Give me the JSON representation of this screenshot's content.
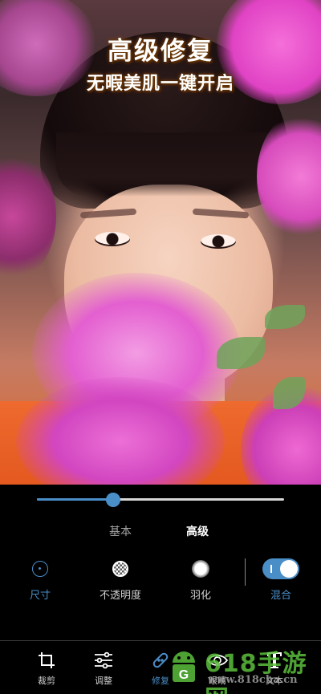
{
  "banner": {
    "title": "高级修复",
    "subtitle": "无暇美肌一键开启"
  },
  "slider": {
    "value": 0.31
  },
  "mode_tabs": [
    {
      "label": "基本",
      "selected": false
    },
    {
      "label": "高级",
      "selected": true
    }
  ],
  "tools": [
    {
      "label": "尺寸",
      "icon": "dot-ring-icon",
      "active": true
    },
    {
      "label": "不透明度",
      "icon": "checker-circle-icon",
      "active": false
    },
    {
      "label": "羽化",
      "icon": "soft-dot-icon",
      "active": false
    },
    {
      "label": "混合",
      "icon": "toggle-on-icon",
      "active": true
    }
  ],
  "bottom_nav": [
    {
      "label": "裁剪",
      "icon": "crop-icon",
      "active": false
    },
    {
      "label": "调整",
      "icon": "sliders-icon",
      "active": false
    },
    {
      "label": "修复",
      "icon": "bandage-icon",
      "active": true
    },
    {
      "label": "眼睛",
      "icon": "eye-icon",
      "active": false
    },
    {
      "label": "文本",
      "icon": "text-icon",
      "active": false
    }
  ],
  "watermark": {
    "brand": "618手游网",
    "url": "www.818cha.cn"
  },
  "colors": {
    "accent": "#4a8ec8",
    "background": "#000000",
    "watermark_green": "#5abe3c"
  }
}
